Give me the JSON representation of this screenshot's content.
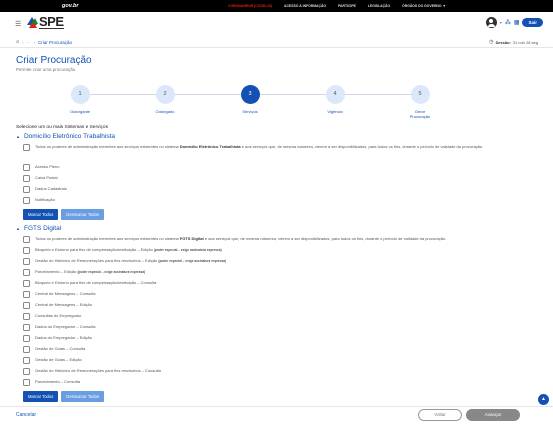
{
  "govbar": {
    "brand": "gov.br",
    "links": [
      "CORONAVÍRUS (COVID-19)",
      "ACESSO À INFORMAÇÃO",
      "PARTICIPE",
      "LEGISLAÇÃO",
      "ÓRGÃOS DO GOVERNO ▼"
    ]
  },
  "header": {
    "logo_text": "SPE",
    "sair_label": "Sair",
    "icons": {
      "menu": "menu-icon",
      "user": "user-icon",
      "apps": "apps-icon"
    }
  },
  "breadcrumb": {
    "current": "Criar Procuração"
  },
  "session": {
    "label": "Sessão:",
    "value": "31 min 28 seg"
  },
  "page": {
    "title": "Criar Procuração",
    "subtitle": "Permite criar uma procuração"
  },
  "steps": [
    {
      "number": "1",
      "label": "Outorgante"
    },
    {
      "number": "2",
      "label": "Outorgado"
    },
    {
      "number": "3",
      "label": "Serviços",
      "active": true
    },
    {
      "number": "4",
      "label": "Vigência"
    },
    {
      "number": "5",
      "label": "Gerar Procuração"
    }
  ],
  "prompt": "Selecione um ou mais Sistemas e Serviços",
  "groups": [
    {
      "title": "Domicílio Eletrônico Trabalhista",
      "all_option": {
        "pre": "Todos os poderes de administração inerentes aos serviços existentes no sistema ",
        "bold": "Domicílio Eletrônico Trabalhista",
        "post": " e aos serviços que, de mesma natureza, vierem a ser disponibilizados, para todos os fins, durante o período de validade da procuração."
      },
      "options": [
        "Acesso Pleno",
        "Caixa Postal",
        "Dados Cadastrais",
        "Notificação"
      ],
      "mark_all": "Marcar Todos",
      "unmark_all": "Desmarcar Todos"
    },
    {
      "title": "FGTS Digital",
      "all_option": {
        "pre": "Todos os poderes de administração inerentes aos serviços existentes no sistema ",
        "bold": "FGTS Digital",
        "post": " e aos serviços que, de mesma natureza, vierem a ser disponibilizados, para todos os fins, durante o período de validade da procuração."
      },
      "options": [
        {
          "text": "Bloqueio e Estorno para fins de compensação/restituição – Edição",
          "tag": "(poder especial – exige assinatura expressa)"
        },
        {
          "text": "Gestão do Histórico de Remunerações para fins rescisórios – Edição",
          "tag": "(poder especial – exige assinatura expressa)"
        },
        {
          "text": "Parcelamento – Edição",
          "tag": "(poder especial – exige assinatura expressa)"
        },
        {
          "text": "Bloqueio e Estorno para fins de compensação/restituição – Consulta",
          "tag": ""
        },
        {
          "text": "Central de Mensagens – Consulta",
          "tag": ""
        },
        {
          "text": "Central de Mensagens – Edição",
          "tag": ""
        },
        {
          "text": "Consultas do Empregador",
          "tag": ""
        },
        {
          "text": "Dados do Empregador – Consulta",
          "tag": ""
        },
        {
          "text": "Dados do Empregador – Edição",
          "tag": ""
        },
        {
          "text": "Gestão de Guias – Consulta",
          "tag": ""
        },
        {
          "text": "Gestão de Guias – Edição",
          "tag": ""
        },
        {
          "text": "Gestão do Histórico de Remunerações para fins rescisórios – Consulta",
          "tag": ""
        },
        {
          "text": "Parcelamento – Consulta",
          "tag": ""
        }
      ],
      "mark_all": "Marcar Todos",
      "unmark_all": "Desmarcar Todos"
    }
  ],
  "footer": {
    "cancel": "Cancelar",
    "back": "Voltar",
    "next": "Avançar"
  },
  "colors": {
    "primary": "#1351b4",
    "govbar": "#000000",
    "alert": "#e52207"
  }
}
